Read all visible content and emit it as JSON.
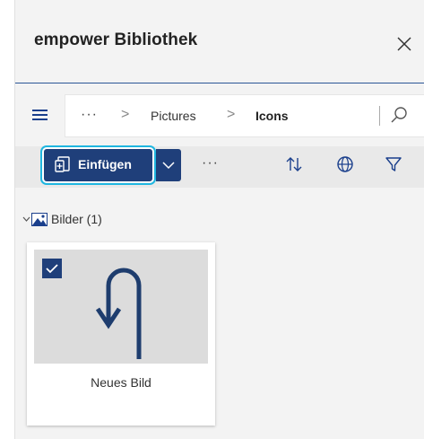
{
  "header": {
    "title": "empower Bibliothek",
    "close_icon": "close-icon"
  },
  "breadcrumb": {
    "ellipsis": "···",
    "separator": ">",
    "items": [
      "Pictures",
      "Icons"
    ]
  },
  "toolbar": {
    "insert_label": "Einfügen",
    "more_label": "···",
    "icons": [
      "insert-document-icon",
      "chevron-down-icon",
      "sort-icon",
      "globe-icon",
      "filter-icon"
    ]
  },
  "group": {
    "label": "Bilder (1)",
    "icon": "image-icon"
  },
  "tiles": [
    {
      "label": "Neues Bild",
      "checked": true,
      "thumbnail_icon": "u-turn-arrow-icon"
    }
  ],
  "colors": {
    "accent": "#1f3f7a",
    "focus_ring": "#1fb6e0",
    "panel_bg": "#f3f3f3"
  }
}
